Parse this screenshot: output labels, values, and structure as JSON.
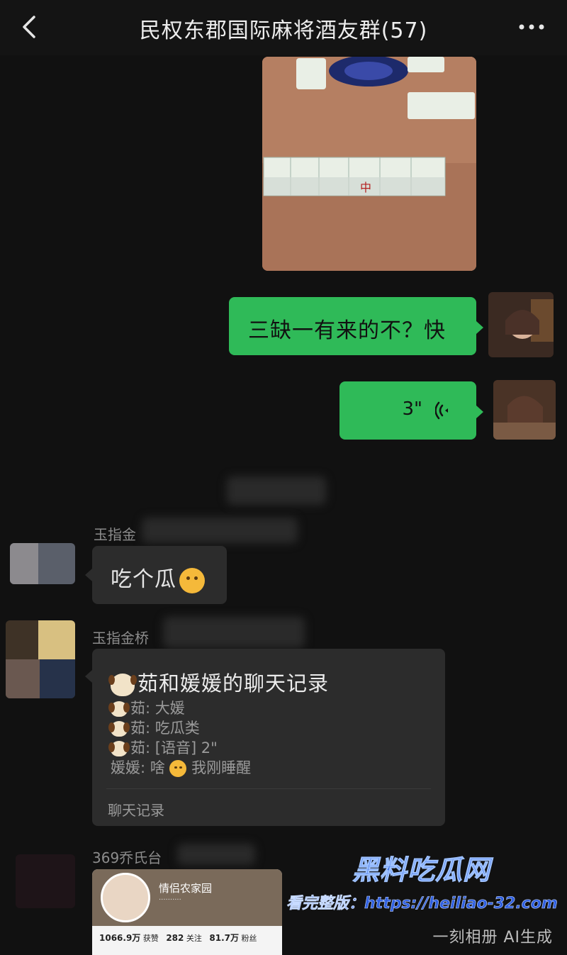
{
  "header": {
    "title": "民权东郡国际麻将酒友群(57)"
  },
  "messages": {
    "text_1": "三缺一有来的不？快",
    "voice_duration": "3\"",
    "text_2": "吃个瓜",
    "sender_2": "玉指金",
    "sender_3": "玉指金桥",
    "sender_4": "369乔氏台",
    "record": {
      "title": "茹和媛媛的聊天记录",
      "line_1": "茹: 大媛",
      "line_2": "茹: 吃瓜类",
      "line_3": "茹: [语音] 2\"",
      "line_4_a": "媛媛: 啥",
      "line_4_b": "我刚睡醒",
      "footer": "聊天记录"
    },
    "card": {
      "name": "情侣农家园",
      "followers": "1066.9万",
      "followers_label": "获赞",
      "following": "282",
      "following_label": "关注",
      "fans": "81.7万",
      "fans_label": "粉丝"
    }
  },
  "watermark": {
    "logo": "黑料吃瓜网",
    "url": "看完整版：https://heiliao-32.com",
    "ai": "一刻相册 AI生成"
  },
  "colors": {
    "background": "#111111",
    "green_bubble": "#2fba58",
    "grey_bubble": "#2c2c2c"
  }
}
